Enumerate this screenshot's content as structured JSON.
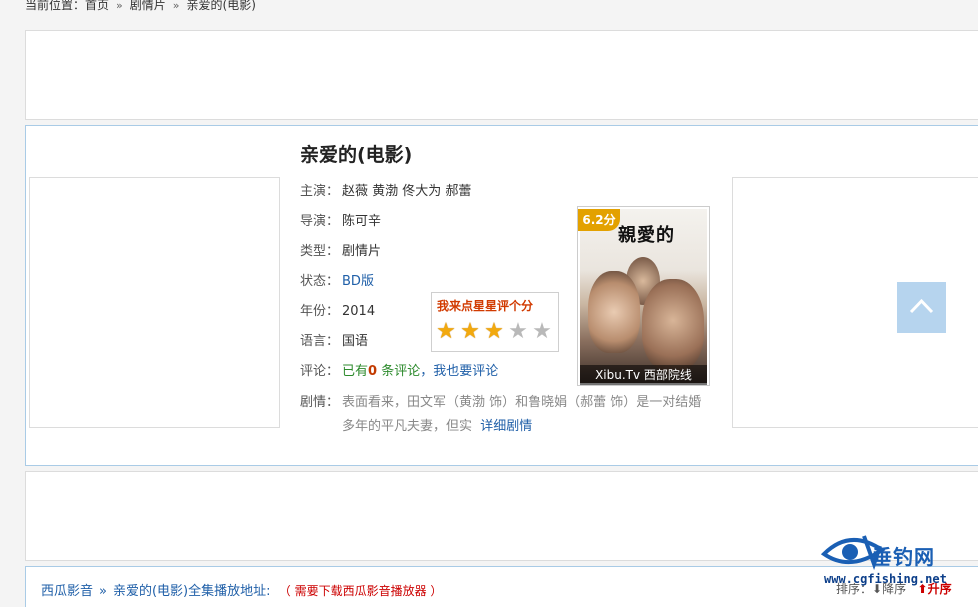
{
  "breadcrumb": {
    "prefix": "当前位置：",
    "home": "首页",
    "sep": "»",
    "category": "剧情片",
    "current": "亲爱的(电影)"
  },
  "movie": {
    "title": "亲爱的(电影)",
    "rows": [
      {
        "label": "主演：",
        "value": "赵薇 黄渤 佟大为 郝蕾"
      },
      {
        "label": "导演：",
        "value": "陈可辛"
      },
      {
        "label": "类型：",
        "value": "剧情片"
      },
      {
        "label": "状态：",
        "value": "BD版"
      },
      {
        "label": "年份：",
        "value": "2014"
      },
      {
        "label": "语言：",
        "value": "国语"
      }
    ],
    "comments": {
      "label": "评论：",
      "prefix": "已有",
      "count": "0",
      "suffix": " 条评论",
      "comma": "，",
      "link": "我也要评论"
    },
    "plot": {
      "label": "剧情：",
      "text": "表面看来，田文军（黄渤 饰）和鲁晓娟（郝蕾 饰）是一对结婚多年的平凡夫妻，但实",
      "more": "详细剧情"
    }
  },
  "rating": {
    "title": "我来点星星评个分",
    "stars_on": 3,
    "stars_total": 5,
    "star_glyph": "★"
  },
  "poster": {
    "score": "6.2分",
    "title": "親愛的",
    "footer": "Xibu.Tv 西部院线"
  },
  "playlist": {
    "source": "西瓜影音",
    "sep": "»",
    "title": "亲爱的(电影)全集播放地址:",
    "note": "（ 需要下载西瓜影音播放器 ）"
  },
  "sort": {
    "label": "排序：",
    "down": "降序",
    "up": "升序"
  },
  "watermark": {
    "name": "垂钓网",
    "url": "www.cgfishing.net"
  },
  "colors": {
    "link": "#1f5fa8",
    "accent": "#d13a00",
    "star_on": "#f2a90e",
    "star_off": "#b9b9b9",
    "back_top": "#b6d4ee"
  }
}
